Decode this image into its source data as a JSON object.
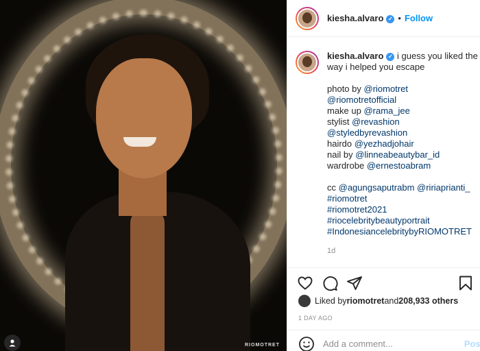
{
  "photo": {
    "watermark": "RIOMOTRET"
  },
  "header": {
    "username": "kiesha.alvaro",
    "separator": "•",
    "follow_label": "Follow"
  },
  "caption": {
    "username": "kiesha.alvaro",
    "text": "i guess you liked the way i helped you escape",
    "lines": [
      {
        "prefix": "photo by ",
        "link": "@riomotret"
      },
      {
        "prefix": "",
        "link": "@riomotretofficial"
      },
      {
        "prefix": "make up ",
        "link": "@rama_jee"
      },
      {
        "prefix": "stylist ",
        "link": "@revashion"
      },
      {
        "prefix": "",
        "link": "@styledbyrevashion"
      },
      {
        "prefix": "hairdo ",
        "link": "@yezhadjohair"
      },
      {
        "prefix": "nail by ",
        "link": "@linneabeautybar_id"
      },
      {
        "prefix": "wardrobe ",
        "link": "@ernestoabram"
      }
    ],
    "cc_prefix": "cc ",
    "cc_links": [
      "@agungsaputrabm",
      "@ririaprianti_"
    ],
    "hashtags": [
      "#riomotret",
      "#riomotret2021",
      "#riocelebritybeautyportrait",
      "#IndonesiancelebritybyRIOMOTRET"
    ],
    "age": "1d"
  },
  "likes": {
    "prefix": "Liked by ",
    "user": "riomotret",
    "middle": " and ",
    "count": "208,933 others"
  },
  "date": "1 DAY AGO",
  "comment": {
    "placeholder": "Add a comment...",
    "post_label": "Post"
  },
  "colors": {
    "link": "#00376b",
    "follow": "#0095f6",
    "verified": "#3897f0"
  }
}
